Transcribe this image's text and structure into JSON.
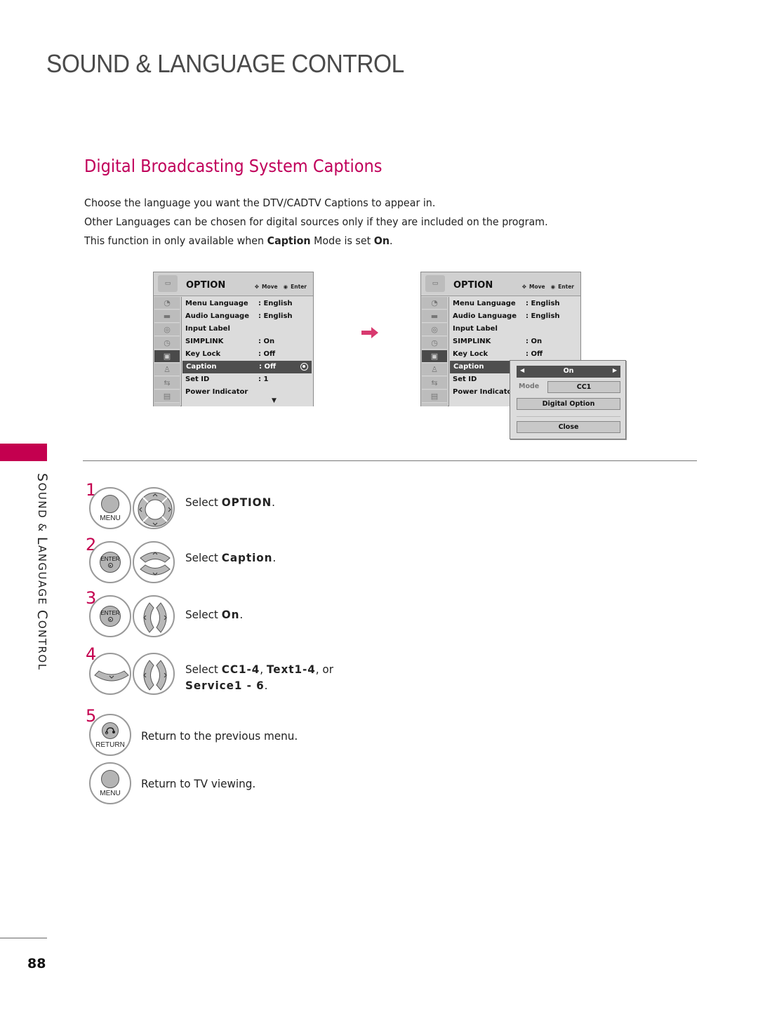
{
  "page": {
    "title": "SOUND & LANGUAGE CONTROL",
    "section_title": "Digital Broadcasting System Captions",
    "intro": {
      "line1": "Choose the language you want the DTV/CADTV Captions to appear in.",
      "line2": "Other Languages can be chosen for digital sources only if they are included on the program.",
      "line3_pre": "This function in only available when ",
      "line3_bold1": "Caption",
      "line3_mid": " Mode is set ",
      "line3_bold2": "On",
      "line3_post": "."
    },
    "side_label_first": "S",
    "side_label_rest1": "OUND ",
    "side_label_amp": "& ",
    "side_label_L": "L",
    "side_label_rest2": "ANGUAGE ",
    "side_label_C": "C",
    "side_label_rest3": "ONTROL",
    "page_number": "88",
    "accent_color": "#c4004f"
  },
  "osd_left": {
    "title": "OPTION",
    "hint_move": "Move",
    "hint_enter": "Enter",
    "rows": [
      {
        "label": "Menu Language",
        "value": ": English"
      },
      {
        "label": "Audio Language",
        "value": ": English"
      },
      {
        "label": "Input Label",
        "value": ""
      },
      {
        "label": "SIMPLINK",
        "value": ": On"
      },
      {
        "label": "Key Lock",
        "value": ": Off"
      },
      {
        "label": "Caption",
        "value": ": Off"
      },
      {
        "label": "Set ID",
        "value": ": 1"
      },
      {
        "label": "Power Indicator",
        "value": ""
      }
    ],
    "selected_index": 5
  },
  "osd_right": {
    "title": "OPTION",
    "hint_move": "Move",
    "hint_enter": "Enter",
    "rows": [
      {
        "label": "Menu Language",
        "value": ": English"
      },
      {
        "label": "Audio Language",
        "value": ": English"
      },
      {
        "label": "Input Label",
        "value": ""
      },
      {
        "label": "SIMPLINK",
        "value": ": On"
      },
      {
        "label": "Key Lock",
        "value": ": Off"
      },
      {
        "label": "Caption",
        "value": ""
      },
      {
        "label": "Set ID",
        "value": ""
      },
      {
        "label": "Power Indicator",
        "value": ""
      }
    ],
    "popup": {
      "state": "On",
      "mode_label": "Mode",
      "mode_value": "CC1",
      "digital_option": "Digital Option",
      "close": "Close"
    }
  },
  "steps": [
    {
      "num": "1",
      "buttons": [
        "MENU"
      ],
      "pre": "Select ",
      "bold": "OPTION",
      "post": "."
    },
    {
      "num": "2",
      "buttons": [
        "ENTER"
      ],
      "pre": "Select ",
      "bold": "Caption",
      "post": "."
    },
    {
      "num": "3",
      "buttons": [
        "ENTER"
      ],
      "pre": "Select ",
      "bold": "On",
      "post": "."
    },
    {
      "num": "4",
      "pre": "Select ",
      "bold": "CC1-4",
      "mid": ", ",
      "bold2": "Text1-4",
      "mid2": ", or",
      "line2_bold": "Service1 - 6",
      "line2_post": "."
    },
    {
      "num": "5",
      "buttons": [
        "RETURN"
      ],
      "text": "Return to the previous menu."
    },
    {
      "buttons": [
        "MENU"
      ],
      "text": "Return to TV viewing."
    }
  ]
}
